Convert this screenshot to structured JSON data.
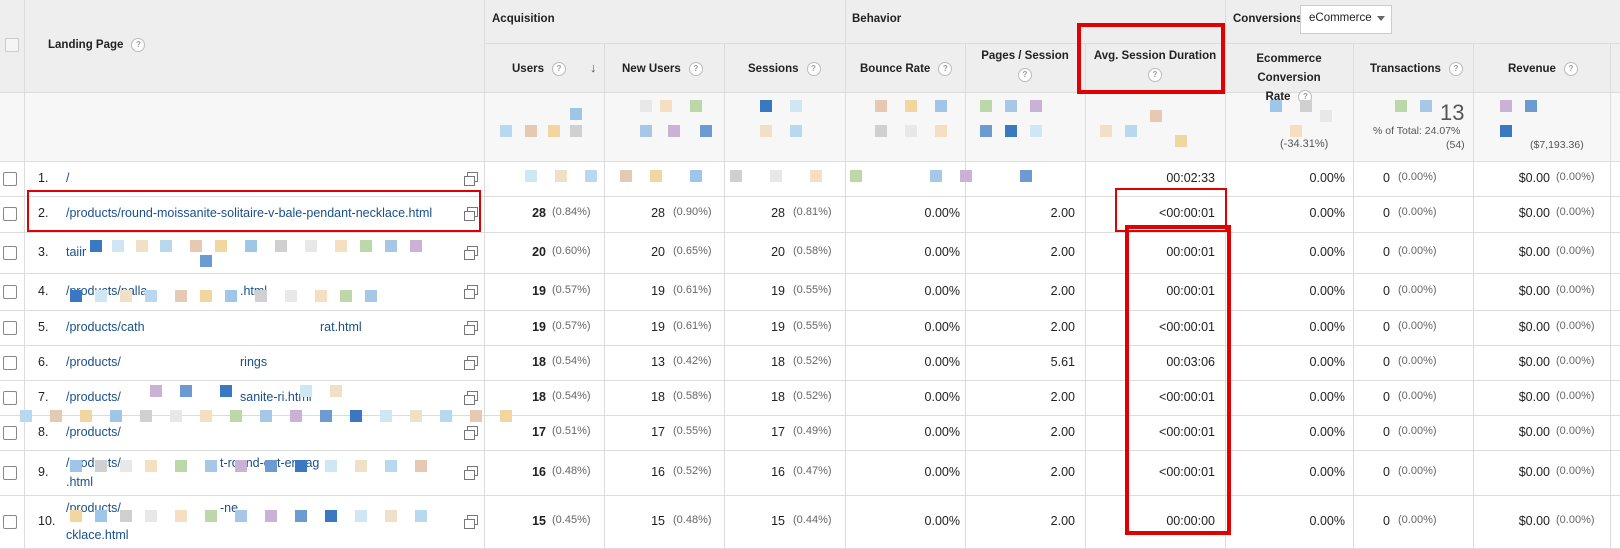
{
  "headers": {
    "landing_page": "Landing Page",
    "groups": {
      "acquisition": "Acquisition",
      "behavior": "Behavior",
      "conversions": "Conversions"
    },
    "conversions_select": "eCommerce",
    "columns": {
      "users": "Users",
      "new_users": "New Users",
      "sessions": "Sessions",
      "bounce_rate": "Bounce Rate",
      "pages_session_1": "Pages / Session",
      "avg_session_duration": "Avg. Session Duration",
      "ecom_rate_1": "Ecommerce Conversion",
      "ecom_rate_2": "Rate",
      "transactions": "Transactions",
      "revenue": "Revenue"
    }
  },
  "totals": {
    "ecom_pct": "(-34.31%)",
    "transactions_value": "13",
    "transactions_pct": "% of Total: 24.07%",
    "transactions_sub": "(54)",
    "revenue_sub": "($7,193.36)"
  },
  "rows": [
    {
      "num": "1.",
      "page": "/",
      "page2": "",
      "users": "",
      "users_pct": "",
      "new_users": "",
      "new_users_pct": "",
      "sessions": "",
      "sessions_pct": "",
      "bounce": "",
      "pages": "",
      "duration": "00:02:33",
      "ecom": "0.00%",
      "trans": "0",
      "trans_pct": "(0.00%)",
      "rev": "$0.00",
      "rev_pct": "(0.00%)"
    },
    {
      "num": "2.",
      "page": "/products/round-moissanite-solitaire-v-bale-pendant-necklace.html",
      "page2": "",
      "users": "28",
      "users_pct": "(0.84%)",
      "new_users": "28",
      "new_users_pct": "(0.90%)",
      "sessions": "28",
      "sessions_pct": "(0.81%)",
      "bounce": "0.00%",
      "pages": "2.00",
      "duration": "<00:00:01",
      "ecom": "0.00%",
      "trans": "0",
      "trans_pct": "(0.00%)",
      "rev": "$0.00",
      "rev_pct": "(0.00%)"
    },
    {
      "num": "3.",
      "page": "taiir",
      "page2": "",
      "users": "20",
      "users_pct": "(0.60%)",
      "new_users": "20",
      "new_users_pct": "(0.65%)",
      "sessions": "20",
      "sessions_pct": "(0.58%)",
      "bounce": "0.00%",
      "pages": "2.00",
      "duration": "00:00:01",
      "ecom": "0.00%",
      "trans": "0",
      "trans_pct": "(0.00%)",
      "rev": "$0.00",
      "rev_pct": "(0.00%)"
    },
    {
      "num": "4.",
      "page": "/products/palla",
      "page2": ".html",
      "users": "19",
      "users_pct": "(0.57%)",
      "new_users": "19",
      "new_users_pct": "(0.61%)",
      "sessions": "19",
      "sessions_pct": "(0.55%)",
      "bounce": "0.00%",
      "pages": "2.00",
      "duration": "00:00:01",
      "ecom": "0.00%",
      "trans": "0",
      "trans_pct": "(0.00%)",
      "rev": "$0.00",
      "rev_pct": "(0.00%)"
    },
    {
      "num": "5.",
      "page": "/products/cath",
      "page2": "rat.html",
      "users": "19",
      "users_pct": "(0.57%)",
      "new_users": "19",
      "new_users_pct": "(0.61%)",
      "sessions": "19",
      "sessions_pct": "(0.55%)",
      "bounce": "0.00%",
      "pages": "2.00",
      "duration": "<00:00:01",
      "ecom": "0.00%",
      "trans": "0",
      "trans_pct": "(0.00%)",
      "rev": "$0.00",
      "rev_pct": "(0.00%)"
    },
    {
      "num": "6.",
      "page": "/products/",
      "page2": "rings",
      "users": "18",
      "users_pct": "(0.54%)",
      "new_users": "13",
      "new_users_pct": "(0.42%)",
      "sessions": "18",
      "sessions_pct": "(0.52%)",
      "bounce": "0.00%",
      "pages": "5.61",
      "duration": "00:03:06",
      "ecom": "0.00%",
      "trans": "0",
      "trans_pct": "(0.00%)",
      "rev": "$0.00",
      "rev_pct": "(0.00%)"
    },
    {
      "num": "7.",
      "page": "/products/",
      "page2": "sanite-ri.html",
      "users": "18",
      "users_pct": "(0.54%)",
      "new_users": "18",
      "new_users_pct": "(0.58%)",
      "sessions": "18",
      "sessions_pct": "(0.52%)",
      "bounce": "0.00%",
      "pages": "2.00",
      "duration": "<00:00:01",
      "ecom": "0.00%",
      "trans": "0",
      "trans_pct": "(0.00%)",
      "rev": "$0.00",
      "rev_pct": "(0.00%)"
    },
    {
      "num": "8.",
      "page": "/products/",
      "page2": "",
      "users": "17",
      "users_pct": "(0.51%)",
      "new_users": "17",
      "new_users_pct": "(0.55%)",
      "sessions": "17",
      "sessions_pct": "(0.49%)",
      "bounce": "0.00%",
      "pages": "2.00",
      "duration": "<00:00:01",
      "ecom": "0.00%",
      "trans": "0",
      "trans_pct": "(0.00%)",
      "rev": "$0.00",
      "rev_pct": "(0.00%)"
    },
    {
      "num": "9.",
      "page": "/products/",
      "page2": "t-round-cut-engag",
      "page3": ".html",
      "users": "16",
      "users_pct": "(0.48%)",
      "new_users": "16",
      "new_users_pct": "(0.52%)",
      "sessions": "16",
      "sessions_pct": "(0.47%)",
      "bounce": "0.00%",
      "pages": "2.00",
      "duration": "<00:00:01",
      "ecom": "0.00%",
      "trans": "0",
      "trans_pct": "(0.00%)",
      "rev": "$0.00",
      "rev_pct": "(0.00%)"
    },
    {
      "num": "10.",
      "page": "/products/",
      "page2": "-ne",
      "page3": "cklace.html",
      "users": "15",
      "users_pct": "(0.45%)",
      "new_users": "15",
      "new_users_pct": "(0.48%)",
      "sessions": "15",
      "sessions_pct": "(0.44%)",
      "bounce": "0.00%",
      "pages": "2.00",
      "duration": "00:00:00",
      "ecom": "0.00%",
      "trans": "0",
      "trans_pct": "(0.00%)",
      "rev": "$0.00",
      "rev_pct": "(0.00%)"
    }
  ]
}
